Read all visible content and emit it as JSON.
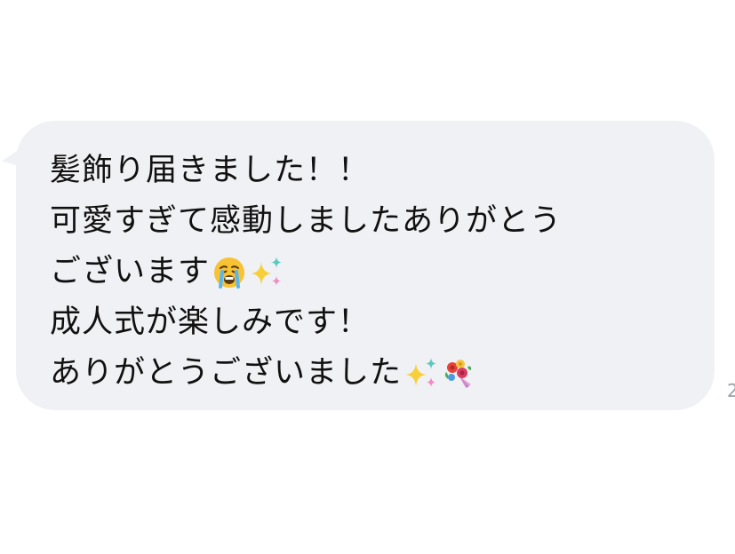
{
  "message": {
    "lines": [
      "髪飾り届きました！！",
      "可愛すぎて感動しましたありがとう",
      "ございます",
      "成人式が楽しみです！",
      "ありがとうございました"
    ],
    "emojis": {
      "line3": [
        "crying-face-emoji",
        "sparkles-emoji"
      ],
      "line5": [
        "sparkles-emoji",
        "bouquet-emoji"
      ]
    },
    "timestamp": "2"
  },
  "colors": {
    "background": "#ffffff",
    "bubble": "#f0f1f4",
    "text": "#111111",
    "timestamp": "#9aa0a6"
  }
}
